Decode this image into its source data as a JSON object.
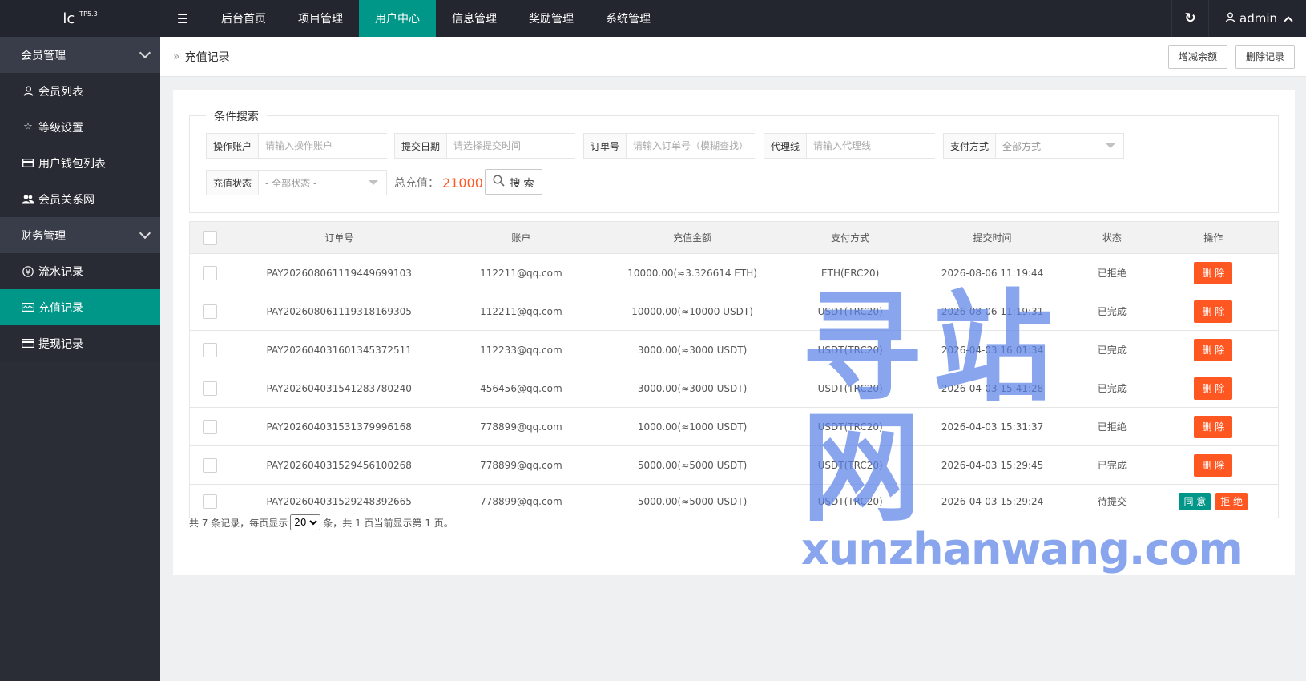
{
  "app": {
    "logo": "lc",
    "version": "TP5.3"
  },
  "topnav": {
    "toggle_icon": "menu-icon",
    "items": [
      {
        "label": "后台首页",
        "active": false
      },
      {
        "label": "项目管理",
        "active": false
      },
      {
        "label": "用户中心",
        "active": true
      },
      {
        "label": "信息管理",
        "active": false
      },
      {
        "label": "奖励管理",
        "active": false
      },
      {
        "label": "系统管理",
        "active": false
      }
    ],
    "user": "admin"
  },
  "sidebar": {
    "groups": [
      {
        "label": "会员管理",
        "items": [
          {
            "label": "会员列表",
            "icon": "user-icon"
          },
          {
            "label": "等级设置",
            "icon": "star-icon"
          },
          {
            "label": "用户钱包列表",
            "icon": "card-icon"
          },
          {
            "label": "会员关系网",
            "icon": "users-icon"
          }
        ]
      },
      {
        "label": "财务管理",
        "items": [
          {
            "label": "流水记录",
            "icon": "yen-icon"
          },
          {
            "label": "充值记录",
            "icon": "wave-icon",
            "active": true
          },
          {
            "label": "提现记录",
            "icon": "card-icon"
          }
        ]
      }
    ]
  },
  "page": {
    "title": "充值记录",
    "buttons": {
      "adjust": "增减余额",
      "delete": "删除记录"
    }
  },
  "search": {
    "legend": "条件搜索",
    "account": {
      "label": "操作账户",
      "placeholder": "请输入操作账户"
    },
    "date": {
      "label": "提交日期",
      "placeholder": "请选择提交时间"
    },
    "order": {
      "label": "订单号",
      "placeholder": "请输入订单号（模糊查找）"
    },
    "agent": {
      "label": "代理线",
      "placeholder": "请输入代理线"
    },
    "pay": {
      "label": "支付方式",
      "value": "全部方式"
    },
    "status": {
      "label": "充值状态",
      "value": "- 全部状态 -"
    },
    "total_label": "总充值：",
    "total_value": "21000",
    "search_button": "搜 索"
  },
  "table": {
    "headers": [
      "订单号",
      "账户",
      "充值金额",
      "支付方式",
      "提交时间",
      "状态",
      "操作"
    ],
    "rows": [
      {
        "order": "PAY202608061119449699103",
        "account": "112211@qq.com",
        "amount": "10000.00(≈3.326614 ETH)",
        "method": "ETH(ERC20)",
        "time": "2026-08-06 11:19:44",
        "status": "已拒绝",
        "status_type": "rej",
        "action": "删 除"
      },
      {
        "order": "PAY202608061119318169305",
        "account": "112211@qq.com",
        "amount": "10000.00(≈10000 USDT)",
        "method": "USDT(TRC20)",
        "time": "2026-08-06 11:19:31",
        "status": "已完成",
        "status_type": "done",
        "action": "删 除"
      },
      {
        "order": "PAY202604031601345372511",
        "account": "112233@qq.com",
        "amount": "3000.00(≈3000 USDT)",
        "method": "USDT(TRC20)",
        "time": "2026-04-03 16:01:34",
        "status": "已完成",
        "status_type": "done",
        "action": "删 除"
      },
      {
        "order": "PAY202604031541283780240",
        "account": "456456@qq.com",
        "amount": "3000.00(≈3000 USDT)",
        "method": "USDT(TRC20)",
        "time": "2026-04-03 15:41:28",
        "status": "已完成",
        "status_type": "done",
        "action": "删 除"
      },
      {
        "order": "PAY202604031531379996168",
        "account": "778899@qq.com",
        "amount": "1000.00(≈1000 USDT)",
        "method": "USDT(TRC20)",
        "time": "2026-04-03 15:31:37",
        "status": "已拒绝",
        "status_type": "rej",
        "action": "删 除"
      },
      {
        "order": "PAY202604031529456100268",
        "account": "778899@qq.com",
        "amount": "5000.00(≈5000 USDT)",
        "method": "USDT(TRC20)",
        "time": "2026-04-03 15:29:45",
        "status": "已完成",
        "status_type": "done",
        "action": "删 除"
      },
      {
        "order": "PAY202604031529248392665",
        "account": "778899@qq.com",
        "amount": "5000.00(≈5000 USDT)",
        "method": "USDT(TRC20)",
        "time": "2026-04-03 15:29:24",
        "status": "待提交",
        "status_type": "wait",
        "approve": "同 意",
        "reject": "拒 绝"
      }
    ]
  },
  "pager": {
    "prefix": "共 7 条记录，每页显示",
    "page_size": "20",
    "suffix": "条，共 1 页当前显示第 1 页。"
  },
  "watermark": {
    "cn": "寻站网",
    "en": "xunzhanwang.com"
  },
  "colors": {
    "accent": "#009688",
    "danger": "#ff5722",
    "sidebar": "#2a2d36",
    "topbar": "#23262e"
  }
}
